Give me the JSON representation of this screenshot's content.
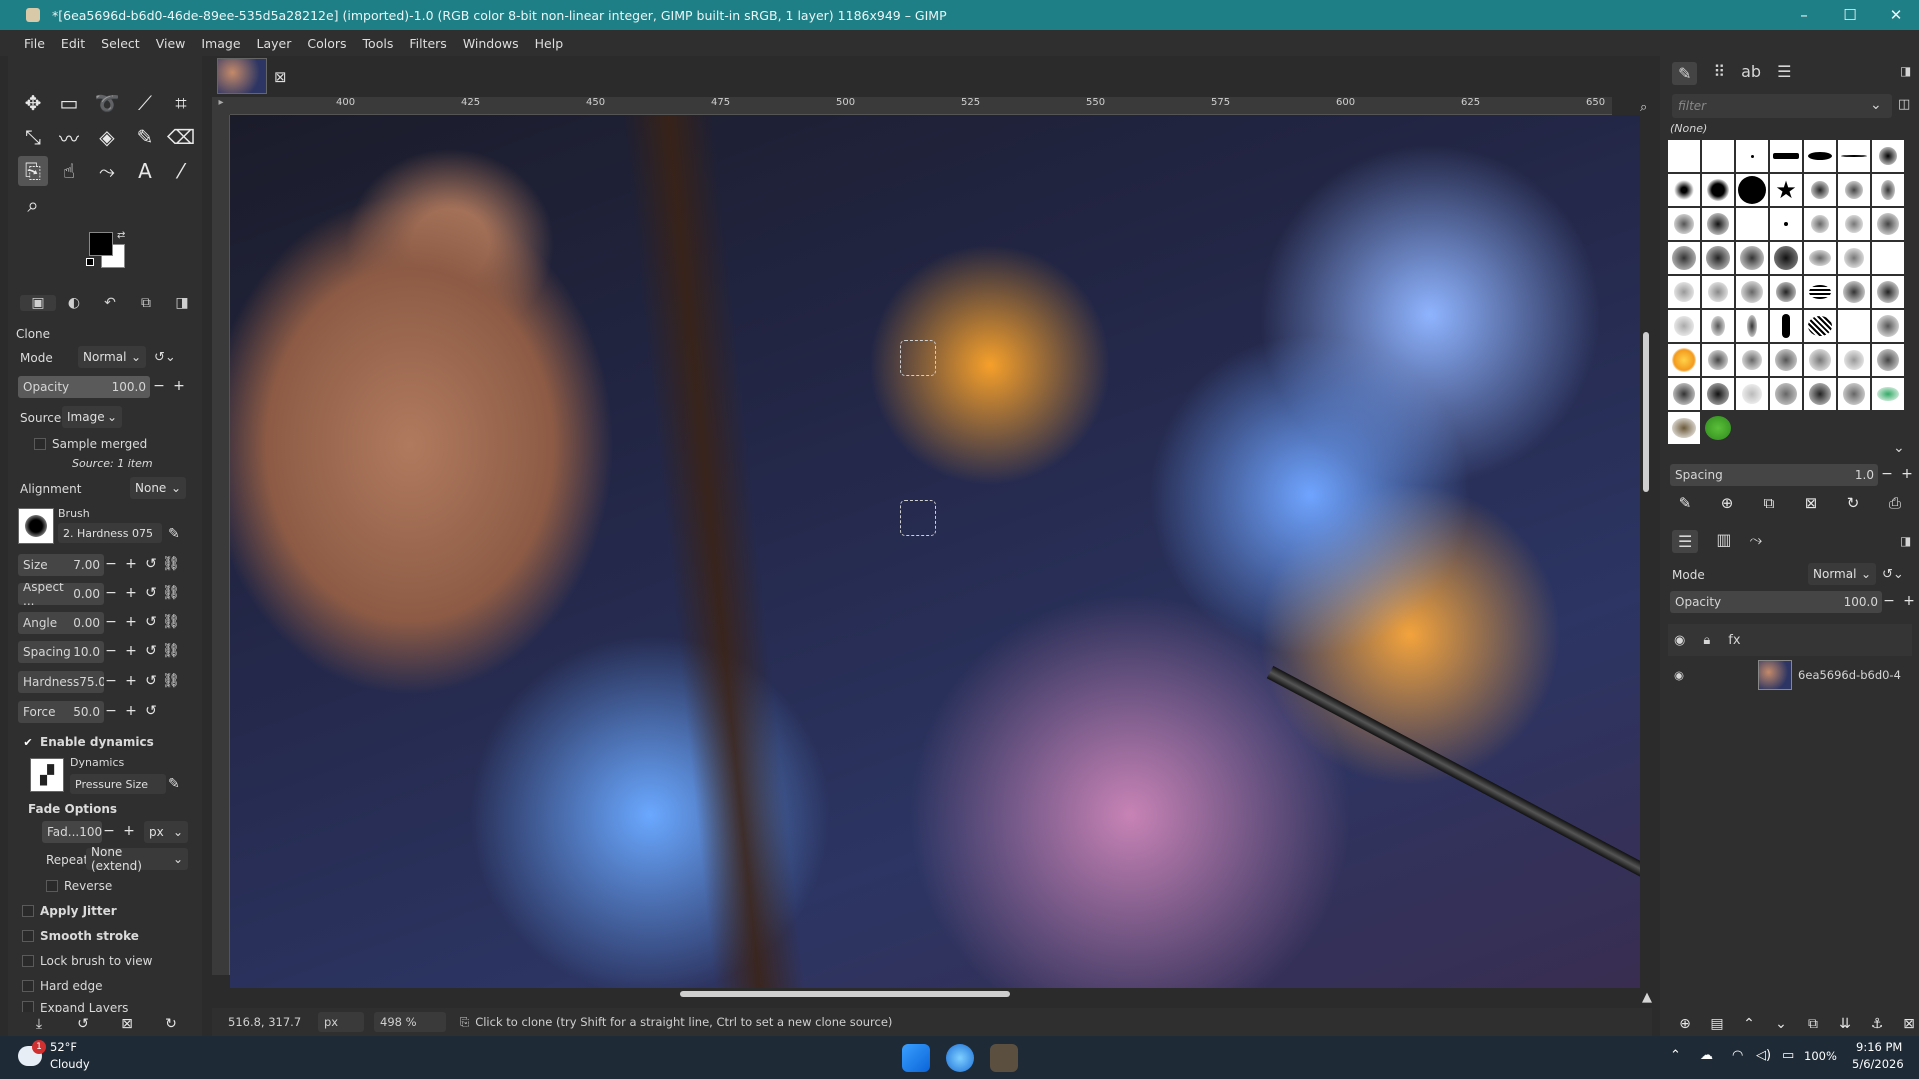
{
  "window": {
    "title": "*[6ea5696d-b6d0-46de-89ee-535d5a28212e] (imported)-1.0 (RGB color 8-bit non-linear integer, GIMP built-in sRGB, 1 layer) 1186x949 – GIMP",
    "minimize": "–",
    "maximize": "☐",
    "close": "✕"
  },
  "menu": [
    "File",
    "Edit",
    "Select",
    "View",
    "Image",
    "Layer",
    "Colors",
    "Tools",
    "Filters",
    "Windows",
    "Help"
  ],
  "tool_options": {
    "title": "Clone",
    "mode_label": "Mode",
    "mode_value": "Normal",
    "opacity_label": "Opacity",
    "opacity_value": "100.0",
    "opacity_fill": 1.0,
    "source_label": "Source",
    "source_value": "Image",
    "sample_merged": "Sample merged",
    "source_info": "Source: 1 item",
    "alignment_label": "Alignment",
    "alignment_value": "None",
    "brush_label": "Brush",
    "brush_name": "2. Hardness 075",
    "size_label": "Size",
    "size_value": "7.00",
    "aspect_label": "Aspect ...",
    "aspect_value": "0.00",
    "angle_label": "Angle",
    "angle_value": "0.00",
    "spacing_label": "Spacing",
    "spacing_value": "10.0",
    "hardness_label": "Hardness",
    "hardness_value": "75.0",
    "force_label": "Force",
    "force_value": "50.0",
    "enable_dynamics": "Enable dynamics",
    "dynamics_label": "Dynamics",
    "dynamics_value": "Pressure Size",
    "fade_options": "Fade Options",
    "fade_label": "Fad...",
    "fade_value": "100",
    "fade_unit": "px",
    "repeat_label": "Repeat",
    "repeat_value": "None (extend)",
    "reverse": "Reverse",
    "apply_jitter": "Apply Jitter",
    "smooth_stroke": "Smooth stroke",
    "lock_brush": "Lock brush to view",
    "hard_edge": "Hard edge",
    "expand_layers": "Expand Layers"
  },
  "ruler": {
    "ticks": [
      "400",
      "425",
      "450",
      "475",
      "500",
      "525",
      "550",
      "575",
      "600",
      "625",
      "650"
    ]
  },
  "status": {
    "coords": "516.8, 317.7",
    "unit": "px",
    "zoom": "498 %",
    "message": "Click to clone (try Shift for a straight line, Ctrl to set a new clone source)"
  },
  "brushes_panel": {
    "filter_placeholder": "filter",
    "selected": "(None)",
    "spacing_label": "Spacing",
    "spacing_value": "1.0"
  },
  "layers_panel": {
    "mode_label": "Mode",
    "mode_value": "Normal",
    "opacity_label": "Opacity",
    "opacity_value": "100.0",
    "layer_name": "6ea5696d-b6d0-4"
  },
  "taskbar": {
    "temp": "52°F",
    "weather": "Cloudy",
    "weather_badge": "1",
    "battery": "100%",
    "time": "9:16 PM",
    "date": "5/6/2026"
  }
}
